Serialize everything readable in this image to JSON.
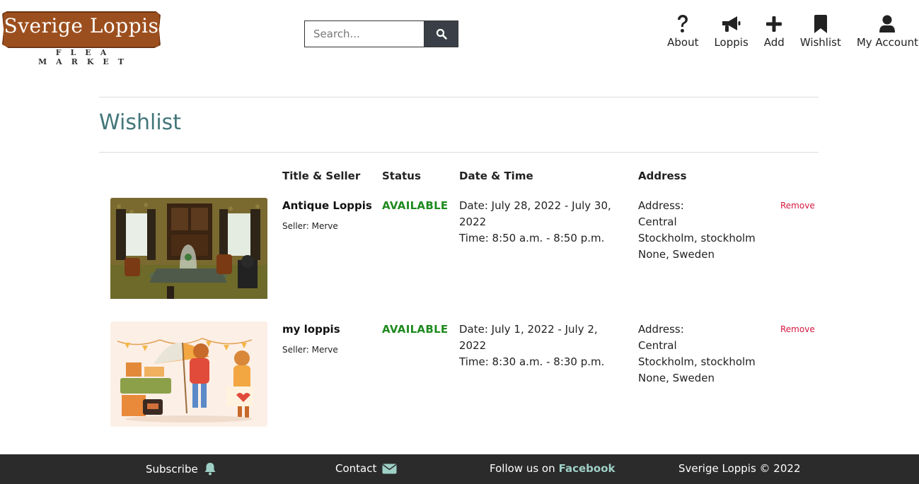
{
  "logo": {
    "title": "Sverige Loppis",
    "subtitle": "FLEA MARKET"
  },
  "search": {
    "placeholder": "Search..."
  },
  "nav": {
    "about": "About",
    "loppis": "Loppis",
    "add": "Add",
    "wishlist": "Wishlist",
    "account": "My Account"
  },
  "page": {
    "title": "Wishlist"
  },
  "table": {
    "headers": {
      "title_seller": "Title & Seller",
      "status": "Status",
      "date_time": "Date & Time",
      "address": "Address"
    },
    "rows": [
      {
        "image": "antique-interior-photo",
        "title": "Antique Loppis",
        "seller": "Seller: Merve",
        "status": "AVAILABLE",
        "date": "Date: July 28, 2022 - July 30, 2022",
        "time": "Time: 8:50 a.m. - 8:50 p.m.",
        "address_label": "Address:",
        "address_street": "Central",
        "address_city": "Stockholm, stockholm",
        "address_country": "None, Sweden",
        "remove": "Remove"
      },
      {
        "image": "flea-market-illustration",
        "title": "my loppis",
        "seller": "Seller: Merve",
        "status": "AVAILABLE",
        "date": "Date: July 1, 2022 - July 2, 2022",
        "time": "Time: 8:30 a.m. - 8:30 p.m.",
        "address_label": "Address:",
        "address_street": "Central",
        "address_city": "Stockholm, stockholm",
        "address_country": "None, Sweden",
        "remove": "Remove"
      }
    ]
  },
  "footer": {
    "subscribe": "Subscribe",
    "contact": "Contact",
    "follow_prefix": "Follow us on",
    "follow_link": "Facebook",
    "copyright": "Sverige Loppis © 2022"
  },
  "colors": {
    "accent_title": "#43777a",
    "status_available": "#1e8a1e",
    "remove_link": "#d6173f",
    "footer_bg": "#2b2b2b",
    "footer_link": "#9fd0c6",
    "logo_bg": "#9c4f1e"
  }
}
